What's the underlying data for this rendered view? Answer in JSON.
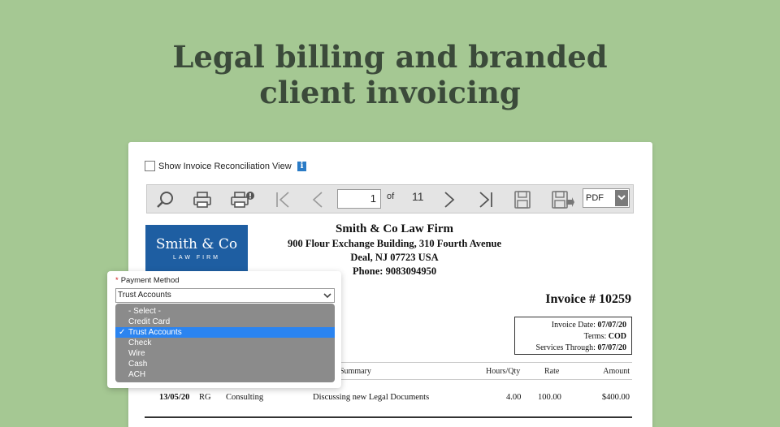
{
  "headline": {
    "line1": "Legal billing and branded",
    "line2": "client invoicing"
  },
  "panel": {
    "recon_label": "Show Invoice Reconciliation View",
    "info_icon": "i",
    "toolbar": {
      "current_page": "1",
      "of_label": "of",
      "total_pages": "11",
      "format": "PDF",
      "icons": [
        "zoom-icon",
        "print-icon",
        "print-options-icon",
        "first-page-icon",
        "prev-page-icon",
        "next-page-icon",
        "last-page-icon",
        "save-icon",
        "export-icon"
      ]
    },
    "logo": {
      "main": "Smith & Co",
      "sub": "LAW FIRM"
    },
    "firm": {
      "name": "Smith & Co Law Firm",
      "address1": "900 Flour Exchange Building, 310 Fourth Avenue",
      "address2": "Deal, NJ 07723 USA",
      "phone": "Phone: 9083094950"
    },
    "invoice_number": "Invoice # 10259",
    "meta": {
      "date_label": "Invoice Date:",
      "date": "07/07/20",
      "terms_label": "Terms:",
      "terms": "COD",
      "through_label": "Services Through:",
      "through": "07/07/20"
    },
    "table": {
      "headers": {
        "summary": "Summary",
        "hours": "Hours/Qty",
        "rate": "Rate",
        "amount": "Amount"
      },
      "rows": [
        {
          "date": "13/05/20",
          "initials": "RG",
          "type": "Consulting",
          "summary": "Discussing new Legal Documents",
          "hours": "4.00",
          "rate": "100.00",
          "amount": "$400.00"
        }
      ]
    }
  },
  "payment_popup": {
    "required_mark": "*",
    "label": "Payment Method",
    "selected": "Trust Accounts",
    "check_mark": "✓",
    "options": [
      "- Select -",
      "Credit Card",
      "Trust Accounts",
      "Check",
      "Wire",
      "Cash",
      "ACH"
    ]
  }
}
